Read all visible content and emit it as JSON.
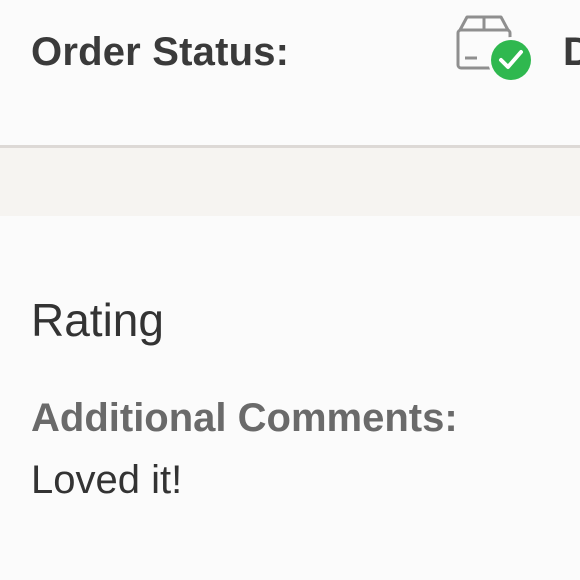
{
  "order_status": {
    "label": "Order Status:",
    "value": "D",
    "icon": "package-delivered-icon",
    "icon_badge_color": "#2fb84f"
  },
  "rating": {
    "heading": "Rating",
    "comments_label": "Additional Comments:",
    "comments_text": "Loved it!"
  }
}
